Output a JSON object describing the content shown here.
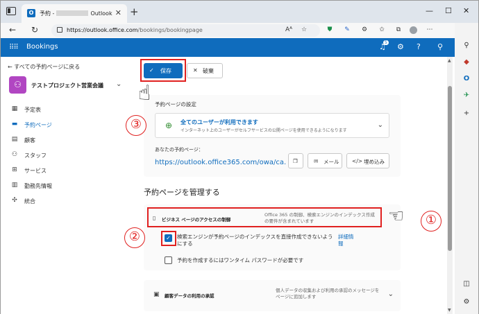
{
  "browser": {
    "tab_title_prefix": "予約 -",
    "tab_title_suffix": "Outlook",
    "new_tab": "+",
    "url_host": "https://outlook.office.com",
    "url_path": "/bookings/bookingpage",
    "read_aloud": "Aᴬ"
  },
  "app": {
    "name": "Bookings",
    "notification_count": "5"
  },
  "leftnav": {
    "back": "← すべての予約ページに戻る",
    "org_initial": "⚇",
    "org_name": "テストプロジェクト営業会議",
    "items": [
      {
        "label": "予定表"
      },
      {
        "label": "予約ページ"
      },
      {
        "label": "顧客"
      },
      {
        "label": "スタッフ"
      },
      {
        "label": "サービス"
      },
      {
        "label": "勤務先情報"
      },
      {
        "label": "統合"
      }
    ]
  },
  "toolbar": {
    "save_label": "保存",
    "discard_label": "破棄"
  },
  "settings": {
    "title": "予約ページの設定",
    "access_title": "全てのユーザーが利用できます",
    "access_sub": "インターネット上のユーザーがセルフサービスの公開ページを使用できるようになります",
    "url_label": "あなたの予約ページ：",
    "page_url": "https://outlook.office365.com/owa/ca...",
    "email_label": "メール",
    "embed_label": "埋め込み"
  },
  "manage": {
    "title": "予約ページを管理する",
    "biz_label": "ビジネス ページのアクセスの制御",
    "biz_desc": "Office 365 の制御、検索エンジンのインデックス作成の要件が含まれています",
    "cb1_label": "検索エンジンが予約ページのインデックスを直接作成できないようにする",
    "cb1_more": "詳細情報",
    "cb2_label": "予約を作成するにはワンタイム パスワードが必要です",
    "consent_label": "顧客データの利用の承認",
    "consent_desc": "個人データの収集および利用の承認のメッセージをページに追加します"
  },
  "annotations": {
    "one": "①",
    "two": "②",
    "three": "③"
  },
  "colors": {
    "brand": "#0f6cbd",
    "highlight": "#e0201f",
    "avatar": "#b146c2"
  }
}
